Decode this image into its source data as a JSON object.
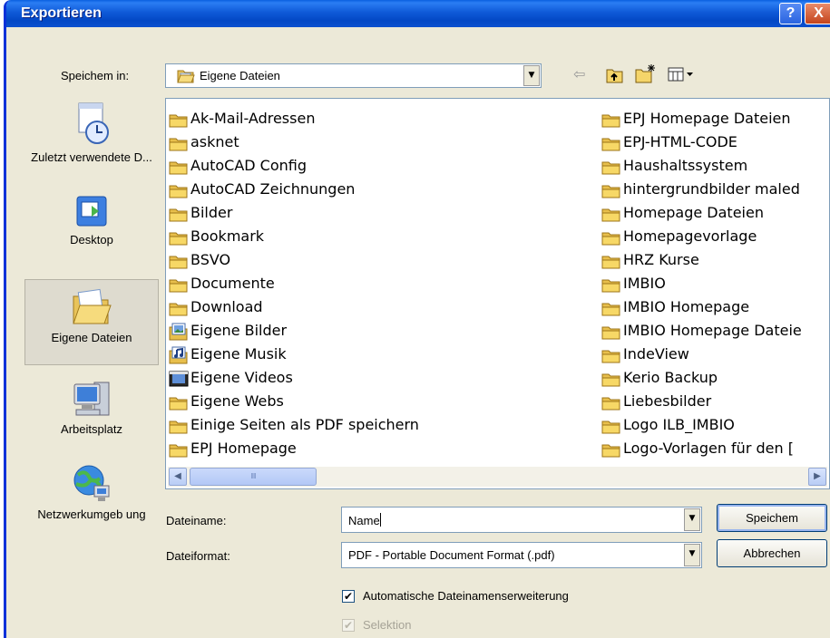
{
  "window": {
    "title": "Exportieren"
  },
  "titlebar": {
    "help": "?",
    "close": "X"
  },
  "lookin": {
    "label": "Speichem in:",
    "value": "Eigene Dateien"
  },
  "places": [
    {
      "name": "recent",
      "label": "Zuletzt verwendete D..."
    },
    {
      "name": "desktop",
      "label": "Desktop"
    },
    {
      "name": "mydocs",
      "label": "Eigene Dateien"
    },
    {
      "name": "mycomputer",
      "label": "Arbeitsplatz"
    },
    {
      "name": "network",
      "label": "Netzwerkumgeb ung"
    }
  ],
  "files": {
    "col1": [
      {
        "name": "Ak-Mail-Adressen",
        "icon": "folder"
      },
      {
        "name": "asknet",
        "icon": "folder"
      },
      {
        "name": "AutoCAD Config",
        "icon": "folder"
      },
      {
        "name": "AutoCAD Zeichnungen",
        "icon": "folder"
      },
      {
        "name": "Bilder",
        "icon": "folder"
      },
      {
        "name": "Bookmark",
        "icon": "folder"
      },
      {
        "name": "BSVO",
        "icon": "folder"
      },
      {
        "name": "Documente",
        "icon": "folder"
      },
      {
        "name": "Download",
        "icon": "folder"
      },
      {
        "name": "Eigene Bilder",
        "icon": "pictures-folder"
      },
      {
        "name": "Eigene Musik",
        "icon": "music-folder"
      },
      {
        "name": "Eigene Videos",
        "icon": "videos-folder"
      },
      {
        "name": "Eigene Webs",
        "icon": "folder"
      },
      {
        "name": "Einige Seiten als PDF speichern",
        "icon": "folder"
      },
      {
        "name": "EPJ Homepage",
        "icon": "folder"
      }
    ],
    "col2": [
      {
        "name": "EPJ Homepage Dateien",
        "icon": "folder"
      },
      {
        "name": "EPJ-HTML-CODE",
        "icon": "folder"
      },
      {
        "name": "Haushaltssystem",
        "icon": "folder"
      },
      {
        "name": "hintergrundbilder maled",
        "icon": "folder"
      },
      {
        "name": "Homepage Dateien",
        "icon": "folder"
      },
      {
        "name": "Homepagevorlage",
        "icon": "folder"
      },
      {
        "name": "HRZ Kurse",
        "icon": "folder"
      },
      {
        "name": "IMBIO",
        "icon": "folder"
      },
      {
        "name": "IMBIO Homepage",
        "icon": "folder"
      },
      {
        "name": "IMBIO Homepage Dateie",
        "icon": "folder"
      },
      {
        "name": "IndeView",
        "icon": "folder"
      },
      {
        "name": "Kerio Backup",
        "icon": "folder"
      },
      {
        "name": "Liebesbilder",
        "icon": "folder"
      },
      {
        "name": "Logo ILB_IMBIO",
        "icon": "folder"
      },
      {
        "name": "Logo-Vorlagen für den [",
        "icon": "folder"
      }
    ]
  },
  "scrollbar": {
    "left": "◀",
    "right": "▶",
    "grip": "IIII"
  },
  "filename": {
    "label": "Dateiname:",
    "value": "Name"
  },
  "fileformat": {
    "label": "Dateiformat:",
    "value": "PDF - Portable Document Format (.pdf)"
  },
  "buttons": {
    "save": "Speichem",
    "cancel": "Abbrechen"
  },
  "options": {
    "auto_extension": {
      "label": "Automatische Dateinamenserweiterung",
      "checked": true
    },
    "selection": {
      "label": "Selektion",
      "checked": true,
      "disabled": true
    }
  },
  "colors": {
    "titlebar": "#0a4fcf",
    "dialog_bg": "#ece9d8",
    "folder": "#f5d56a"
  }
}
